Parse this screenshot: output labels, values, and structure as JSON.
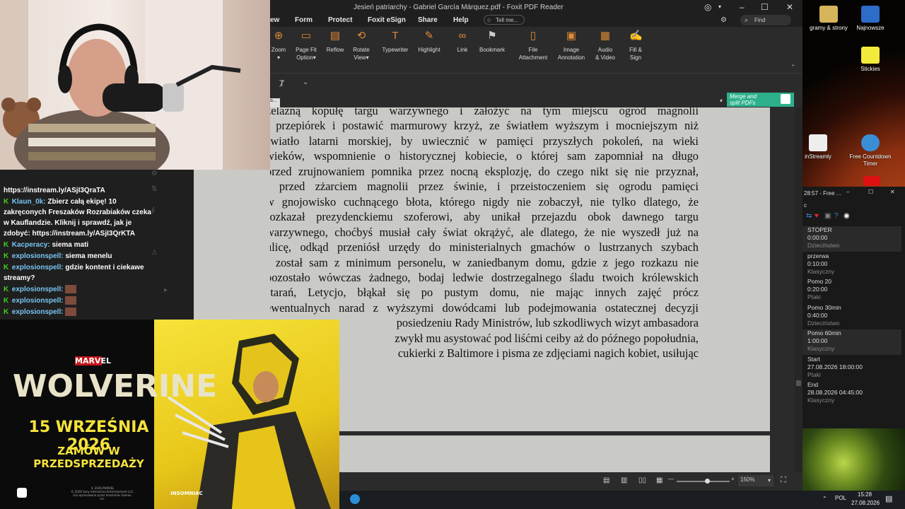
{
  "reader": {
    "title": "Jesień patriarchy - Gabriel García Márquez.pdf - Foxit PDF Reader",
    "menus": [
      "ew",
      "Form",
      "Protect",
      "Foxit eSign",
      "Share",
      "Help"
    ],
    "tell_me": "Tell me...",
    "find": "Find",
    "tools": [
      {
        "label": "Zoom",
        "label2": "",
        "icon": "zoom-icon"
      },
      {
        "label": "Page Fit",
        "label2": "Option",
        "icon": "page-fit-icon"
      },
      {
        "label": "Reflow",
        "label2": "",
        "icon": "reflow-icon"
      },
      {
        "label": "Rotate",
        "label2": "View",
        "icon": "rotate-icon"
      },
      {
        "label": "Typewriter",
        "label2": "",
        "icon": "typewriter-icon"
      },
      {
        "label": "Highlight",
        "label2": "",
        "icon": "highlight-icon"
      },
      {
        "label": "Link",
        "label2": "",
        "icon": "link-icon"
      },
      {
        "label": "Bookmark",
        "label2": "",
        "icon": "bookmark-icon"
      },
      {
        "label": "File",
        "label2": "Attachment",
        "icon": "file-attachment-icon"
      },
      {
        "label": "Image",
        "label2": "Annotation",
        "icon": "image-annotation-icon"
      },
      {
        "label": "Audio",
        "label2": "& Video",
        "icon": "audio-video-icon"
      },
      {
        "label": "Fill &",
        "label2": "Sign",
        "icon": "fill-sign-icon"
      }
    ],
    "merge_banner": [
      "Merge and",
      "split PDFs"
    ],
    "zoom": "150%",
    "accent": "#e08a37",
    "page_lines": [
      "żelazną kopułę targu warzywnego i założyć na tym miejscu ogród magnolii",
      "i przepiórek i postawić marmurowy krzyż, ze światłem wyższym i mocniejszym niż",
      "światło latarni morskiej, by uwiecznić w pamięci przyszłych pokoleń, na wieki",
      "wieków, wspomnienie o historycznej kobiecie, o której sam zapomniał na długo",
      "przed zrujnowaniem pomnika przez nocną eksplozję, do czego nikt się nie przyznał,",
      "i przed zżarciem magnolii przez świnie, i przeistoczeniem się ogrodu pamięci",
      "w gnojowisko cuchnącego błota, którego nigdy nie zobaczył, nie tylko dlatego, że",
      "rozkazał prezydenckiemu szoferowi, aby unikał przejazdu obok dawnego targu",
      "warzywnego, choćbyś musiał cały świat okrążyć, ale dlatego, że nie wyszedł już na",
      "ulicę, odkąd przeniósł urzędy do ministerialnych gmachów o lustrzanych szybach",
      "i został sam z minimum personelu, w zaniedbanym domu, gdzie z jego rozkazu nie",
      "pozostało wówczas żadnego, bodaj ledwie dostrzegalnego śladu twoich królewskich",
      "starań, Letycjo, błąkał się po pustym domu, nie mając innych zajęć prócz",
      "ewentualnych narad z wyższymi dowódcami lub podejmowania ostatecznej decyzji",
      "posiedzeniu Rady Ministrów, lub szkodliwych wizyt ambasadora",
      "zwykł mu asystować pod liśćmi ceiby aż do późnego popołudnia,",
      "cukierki z Baltimore i pisma ze zdjęciami nagich kobiet, usiłując"
    ]
  },
  "chat": {
    "lines": [
      {
        "nick": "",
        "text": "https://instream.ly/ASjI3QraTA",
        "badge": false,
        "emote": false
      },
      {
        "nick": "Klaun_0k:",
        "text": "Zbierz całą ekipę! 10 zakręconych Freszaków Rozrabiaków czeka w Kauflandzie. Kliknij i sprawdź, jak je zdobyć: https://instream.ly/ASjI3QrKTA",
        "badge": true,
        "emote": false
      },
      {
        "nick": "Kacperacy:",
        "text": "siema mati",
        "badge": true,
        "emote": false
      },
      {
        "nick": "explosionspell:",
        "text": "siema menelu",
        "badge": true,
        "emote": false
      },
      {
        "nick": "explosionspell:",
        "text": "gdzie kontent i ciekawe streamy?",
        "badge": true,
        "emote": false
      },
      {
        "nick": "explosionspell:",
        "text": "",
        "badge": true,
        "emote": true
      },
      {
        "nick": "explosionspell:",
        "text": "",
        "badge": true,
        "emote": true
      },
      {
        "nick": "explosionspell:",
        "text": "",
        "badge": true,
        "emote": true
      }
    ]
  },
  "ad": {
    "marvel": "MARVEL",
    "title": "WOLVERINE",
    "date": "15 WRZEŚNIA 2026",
    "cta": "ZAMÓW W PRZEDSPRZEDAŻY",
    "legal": "© 2026 MARVEL\n© 2026 Sony Interactive Entertainment LLC.\nGra opracowana przez Insomniac Games, Inc.",
    "studio": "INSOMNIAC"
  },
  "desktop": {
    "icons": [
      {
        "label": "gramy & strony",
        "icon": "shortcut-icon"
      },
      {
        "label": "Najnowsze",
        "icon": "folder-icon"
      },
      {
        "label": "Stickies",
        "icon": "stickies-icon"
      },
      {
        "label": "inStreamly",
        "icon": "instreamly-icon"
      },
      {
        "label": "Free Countdown Timer",
        "icon": "countdown-timer-icon"
      }
    ]
  },
  "timer_app": {
    "title": "28:57 - Free ...",
    "rows": [
      {
        "name": "STOPER",
        "time": "0:00:00",
        "sub": "Dzieciństwo"
      },
      {
        "name": "przerwa",
        "time": "0:10:00",
        "sub": "Klasyczny"
      },
      {
        "name": "Pomo 20",
        "time": "0:20:00",
        "sub": "Ptaki"
      },
      {
        "name": "Pomo 30min",
        "time": "0:40:00",
        "sub": "Dzieciństwo"
      },
      {
        "name": "Pomo 60min",
        "time": "1:00:00",
        "sub": "Klasyczny"
      },
      {
        "name": "Start",
        "time": "27.08.2026 18:00:00",
        "sub": "Ptaki"
      },
      {
        "name": "End",
        "time": "28.08.2026 04:45:00",
        "sub": "Klasyczny"
      }
    ]
  },
  "taskbar": {
    "lang": "POL",
    "time": "15:28",
    "date": "27.08.2026"
  }
}
